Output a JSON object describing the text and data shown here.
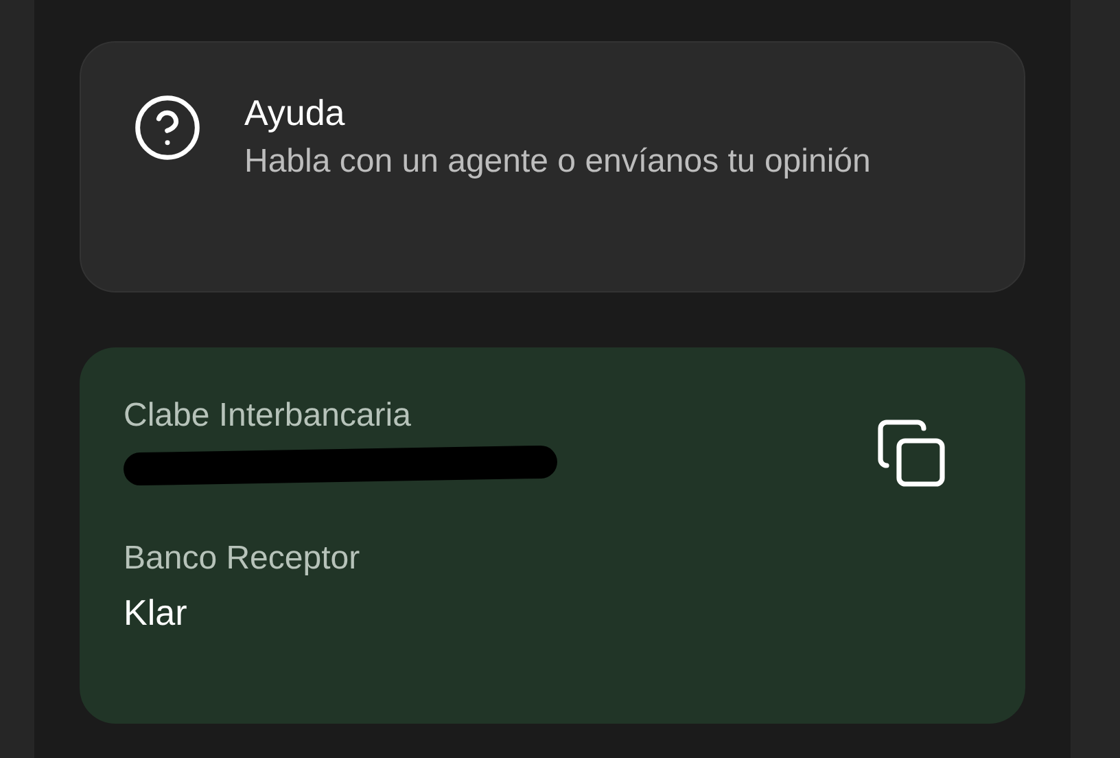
{
  "help_card": {
    "title": "Ayuda",
    "subtitle": "Habla con un agente o envíanos tu opinión"
  },
  "account_card": {
    "fields": [
      {
        "label": "Clabe Interbancaria",
        "redacted": true,
        "copyable": true
      },
      {
        "label": "Banco Receptor",
        "value": "Klar"
      }
    ]
  }
}
